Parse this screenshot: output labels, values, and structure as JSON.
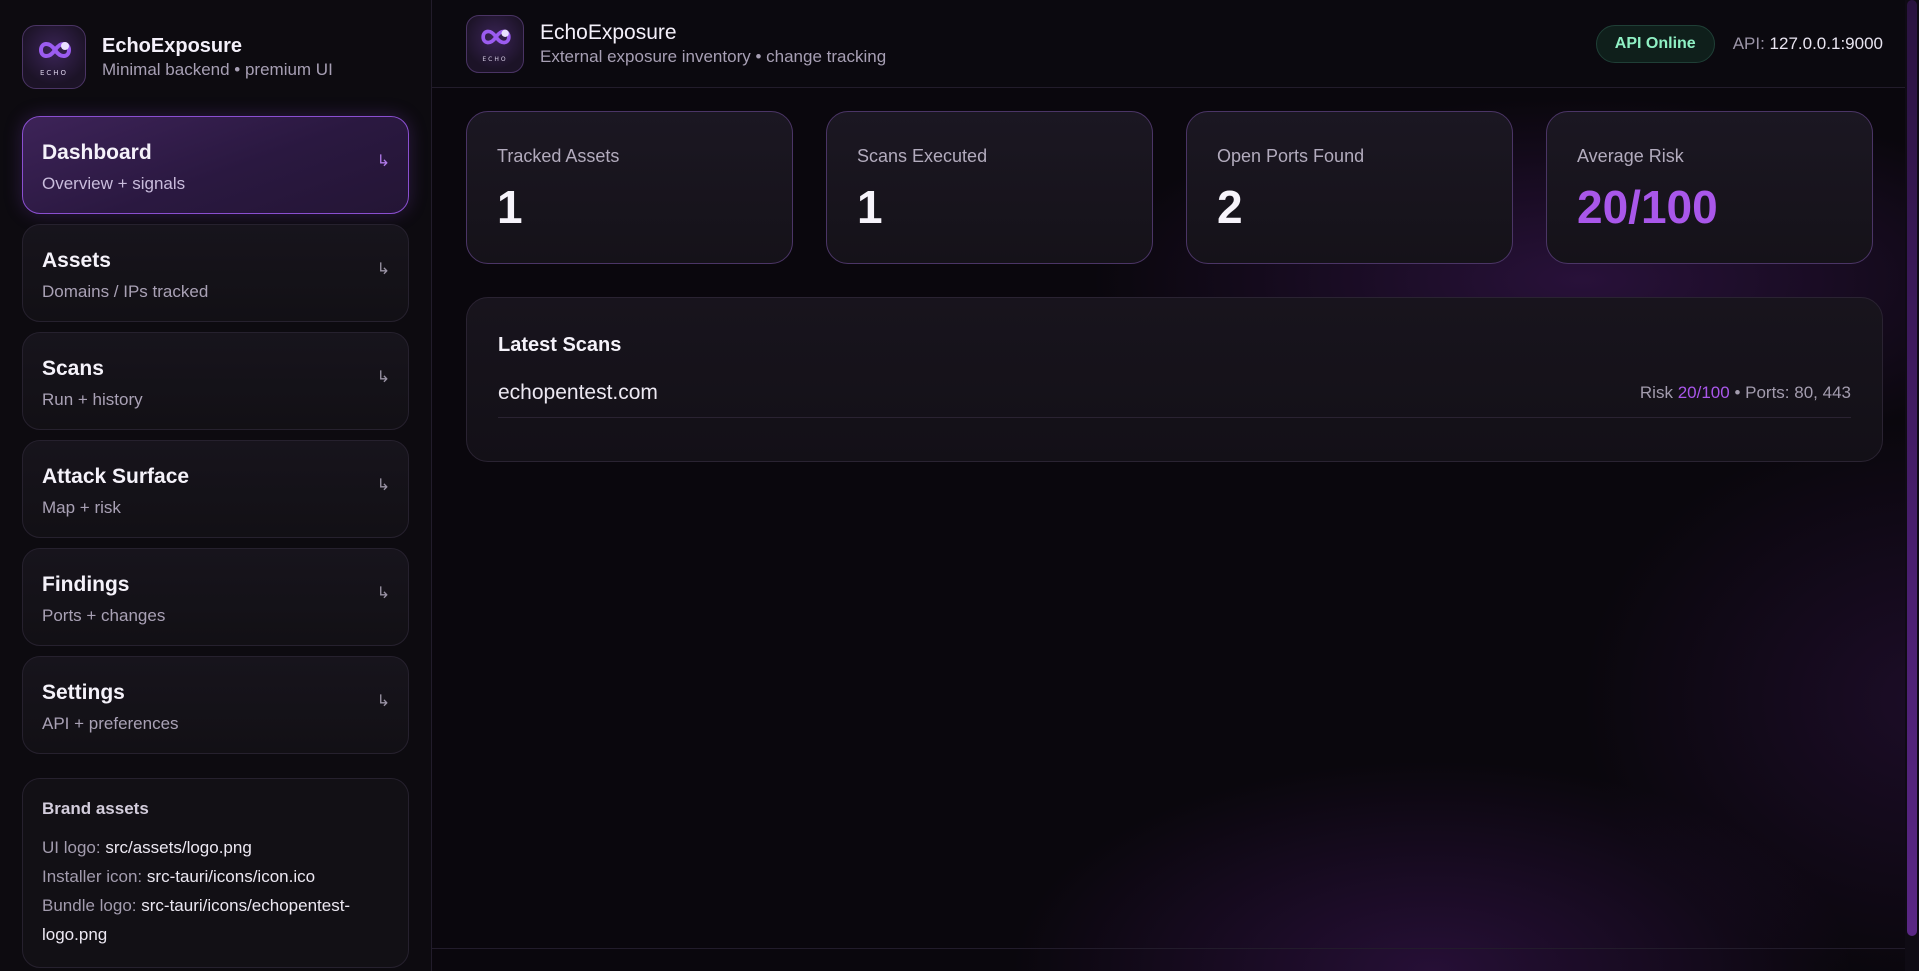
{
  "app": {
    "name": "EchoExposure",
    "tagline": "Minimal backend • premium UI",
    "logo_text": "ECHO"
  },
  "sidebar": {
    "items": [
      {
        "label": "Dashboard",
        "sub": "Overview + signals",
        "active": true
      },
      {
        "label": "Assets",
        "sub": "Domains / IPs tracked",
        "active": false
      },
      {
        "label": "Scans",
        "sub": "Run + history",
        "active": false
      },
      {
        "label": "Attack Surface",
        "sub": "Map + risk",
        "active": false
      },
      {
        "label": "Findings",
        "sub": "Ports + changes",
        "active": false
      },
      {
        "label": "Settings",
        "sub": "API + preferences",
        "active": false
      }
    ],
    "arrow_glyph": "↳",
    "brand_assets": {
      "title": "Brand assets",
      "ui_logo_label": "UI logo:",
      "ui_logo_value": "src/assets/logo.png",
      "installer_icon_label": "Installer icon:",
      "installer_icon_value": "src-tauri/icons/icon.ico",
      "bundle_logo_label": "Bundle logo:",
      "bundle_logo_value": "src-tauri/icons/echopentest-logo.png"
    }
  },
  "header": {
    "title": "EchoExposure",
    "subtitle": "External exposure inventory • change tracking",
    "status": "API Online",
    "api_label": "API:",
    "api_value": "127.0.0.1:9000"
  },
  "stats": [
    {
      "label": "Tracked Assets",
      "value": "1",
      "accent": false
    },
    {
      "label": "Scans Executed",
      "value": "1",
      "accent": false
    },
    {
      "label": "Open Ports Found",
      "value": "2",
      "accent": false
    },
    {
      "label": "Average Risk",
      "value": "20/100",
      "accent": true
    }
  ],
  "latest_scans": {
    "title": "Latest Scans",
    "rows": [
      {
        "host": "echopentest.com",
        "risk_label": "Risk",
        "risk": "20/100",
        "separator": "•",
        "ports_label": "Ports:",
        "ports": "80, 443"
      }
    ]
  },
  "colors": {
    "accent": "#a957ea",
    "status_text": "#8ff0c4",
    "background": "#0a070d"
  },
  "icons": {
    "logo": "infinity-logo-icon",
    "nav_arrow": "arrow-return-icon"
  }
}
